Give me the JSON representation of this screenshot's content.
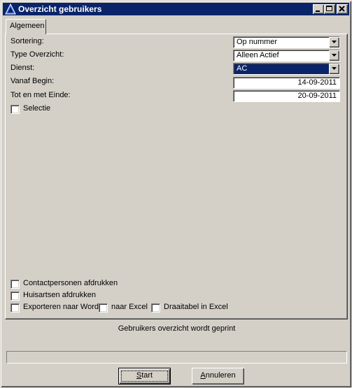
{
  "window": {
    "title": "Overzicht gebruikers",
    "icons": {
      "app": "triangle-app-icon",
      "minimize": "minimize-icon",
      "maximize": "maximize-icon",
      "close": "close-icon"
    }
  },
  "tabs": [
    {
      "label": "Algemeen",
      "active": true
    }
  ],
  "form": {
    "sortering": {
      "label": "Sortering:",
      "value": "Op nummer"
    },
    "type_overzicht": {
      "label": "Type Overzicht:",
      "value": "Alleen Actief"
    },
    "dienst": {
      "label": "Dienst:",
      "value": "AC"
    },
    "vanaf_begin": {
      "label": "Vanaf Begin:",
      "value": "14-09-2011"
    },
    "tot_einde": {
      "label": "Tot en met Einde:",
      "value": "20-09-2011"
    },
    "selectie": {
      "label": "Selectie",
      "checked": false
    }
  },
  "options": {
    "contactpersonen": {
      "label": "Contactpersonen afdrukken",
      "checked": false
    },
    "huisartsen": {
      "label": "Huisartsen afdrukken",
      "checked": false
    },
    "word": {
      "label": "Exporteren naar Word",
      "checked": false
    },
    "excel": {
      "label": "naar Excel",
      "checked": false
    },
    "draaitabel": {
      "label": "Draaitabel in Excel",
      "checked": false
    }
  },
  "status": {
    "text": "Gebruikers overzicht wordt geprint",
    "progress": 0
  },
  "buttons": {
    "start": {
      "mnemonic": "S",
      "rest": "tart"
    },
    "annuleren": {
      "mnemonic": "A",
      "rest": "nnuleren"
    }
  },
  "colors": {
    "face": "#d4d0c8",
    "titlebar": "#0a246a",
    "selection": "#0a246a"
  }
}
